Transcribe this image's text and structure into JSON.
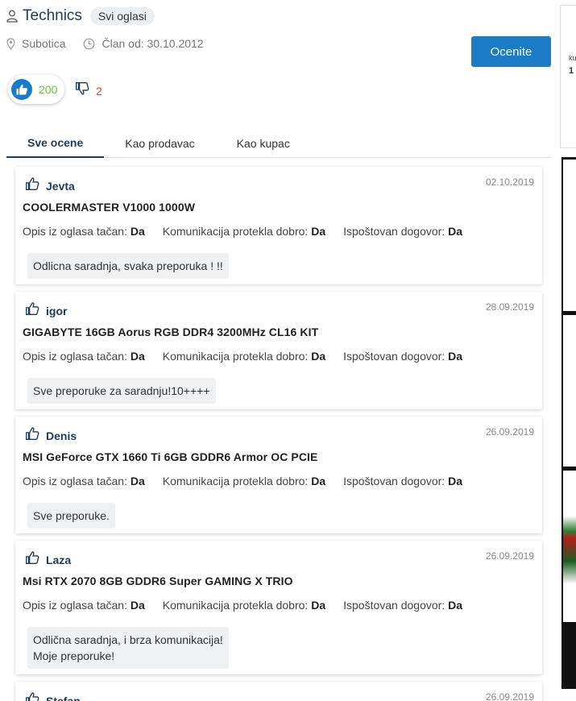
{
  "profile": {
    "username": "Technics",
    "all_ads_label": "Svi oglasi",
    "location": "Subotica",
    "member_since": "Član od: 30.10.2012",
    "rate_button": "Ocenite",
    "likes": "200",
    "dislikes": "2"
  },
  "tabs": [
    {
      "label": "Sve ocene",
      "active": true
    },
    {
      "label": "Kao prodavac",
      "active": false
    },
    {
      "label": "Kao kupac",
      "active": false
    }
  ],
  "attr_labels": {
    "description": "Opis iz oglasa tačan:",
    "communication": "Komunikacija protekla dobro:",
    "agreement": "Ispoštovan dogovor:"
  },
  "reviews": [
    {
      "user": "Jevta",
      "date": "02.10.2019",
      "title": "COOLERMASTER V1000 1000W",
      "description": "Da",
      "communication": "Da",
      "agreement": "Da",
      "comment": "Odlicna saradnja, svaka preporuka ! !!"
    },
    {
      "user": "igor",
      "date": "28.09.2019",
      "title": "GIGABYTE 16GB Aorus RGB DDR4 3200MHz CL16 KIT",
      "description": "Da",
      "communication": "Da",
      "agreement": "Da",
      "comment": "Sve preporuke za saradnju!10++++"
    },
    {
      "user": "Denis",
      "date": "26.09.2019",
      "title": "MSI GeForce GTX 1660 Ti 6GB GDDR6 Armor OC PCIE",
      "description": "Da",
      "communication": "Da",
      "agreement": "Da",
      "comment": "Sve preporuke."
    },
    {
      "user": "Laza",
      "date": "26.09.2019",
      "title": "Msi RTX 2070 8GB GDDR6 Super GAMING X TRIO",
      "description": "Da",
      "communication": "Da",
      "agreement": "Da",
      "comment": "Odlična saradnja, i brza komunikacija!\nMoje preporuke!"
    },
    {
      "user": "Stefan",
      "date": "26.09.2019",
      "title": "",
      "description": "",
      "communication": "",
      "agreement": "",
      "comment": ""
    }
  ],
  "sidebar_fragments": {
    "line1": "ku",
    "line2": "1"
  },
  "colors": {
    "accent": "#1a7bc7",
    "like": "#6cbf3f",
    "dislike": "#d9463b",
    "name": "#1f3b5a"
  }
}
